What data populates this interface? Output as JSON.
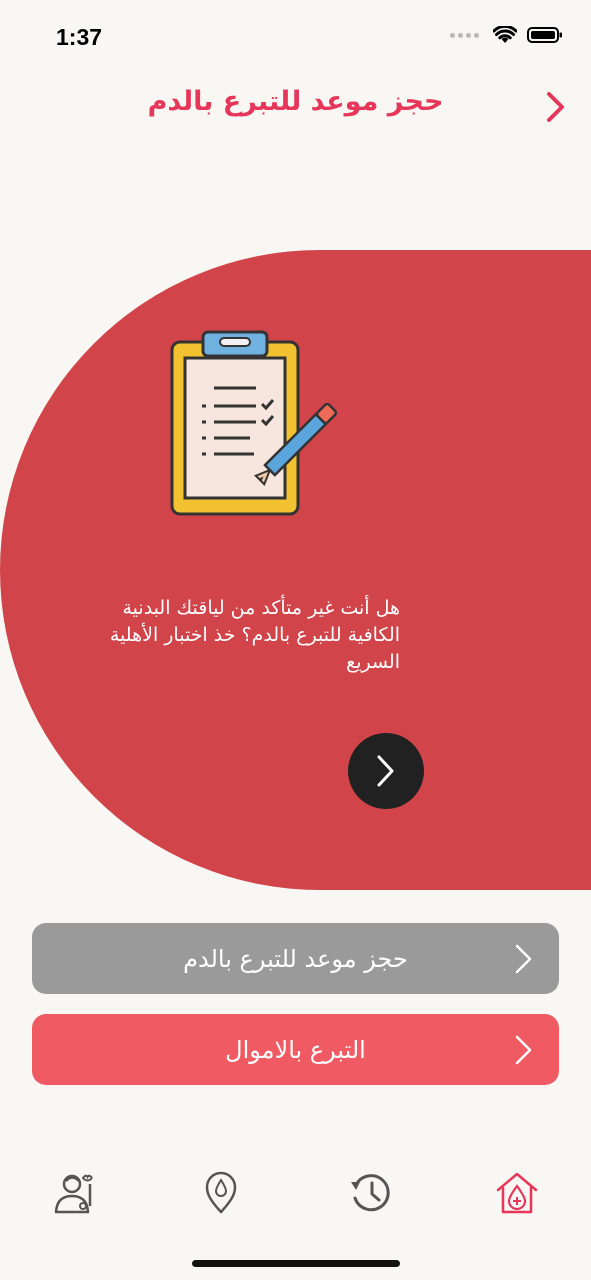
{
  "status_bar": {
    "time": "1:37"
  },
  "header": {
    "title": "حجز موعد للتبرع بالدم",
    "back_icon": "chevron-right-icon"
  },
  "hero": {
    "text": "هل أنت غير متأكد من لياقتك البدنية الكافية للتبرع بالدم؟ خذ اختبار الأهلية السريع",
    "illustration": "clipboard-checklist-icon",
    "next_icon": "chevron-right-icon"
  },
  "actions": {
    "book_blood_label": "حجز موعد للتبرع بالدم",
    "donate_money_label": "التبرع بالاموال"
  },
  "tabs": [
    "profile-icon",
    "location-icon",
    "history-icon",
    "home-icon"
  ],
  "colors": {
    "accent": "#e6375a",
    "hero_bg": "#d0444a",
    "button_gray": "#9a9a9a",
    "button_red": "#f05a62",
    "background": "#f8f7f3"
  }
}
